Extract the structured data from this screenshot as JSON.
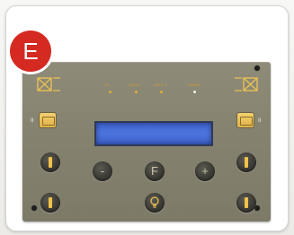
{
  "badge": {
    "letter": "E",
    "color": "#d42a22"
  },
  "panel": {
    "color": "#85826f",
    "top_labels": [
      "A1",
      "AUTO I",
      "AUTO 2",
      "PARAM"
    ],
    "lcd": {
      "color": "#4a70dc",
      "text": ""
    },
    "side_labels": [
      "II",
      "II"
    ],
    "buttons": {
      "left_up": "arrow-up",
      "left_down": "arrow-down",
      "minus_label": "-",
      "f_label": "F",
      "plus_label": "+",
      "light": "bulb",
      "right_up": "arrow-up",
      "right_down": "arrow-down"
    }
  }
}
